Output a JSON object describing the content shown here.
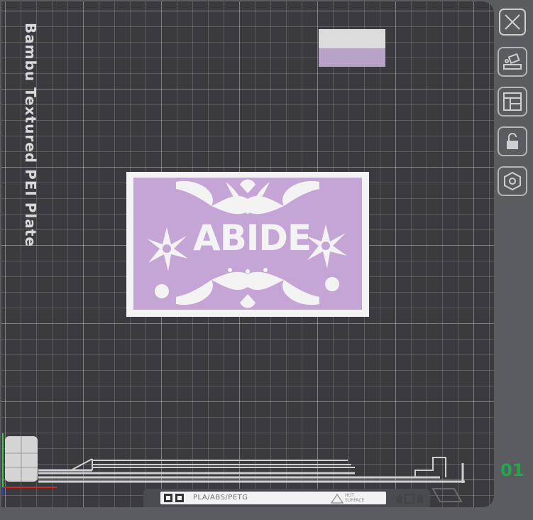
{
  "plate": {
    "name": "Bambu Textured PEI Plate",
    "number": "01",
    "material_label": "PLA/ABS/PETG",
    "hot_surface_label": [
      "HOT",
      "SURFACE"
    ]
  },
  "model": {
    "text": "ABIDE"
  },
  "colors": {
    "plate_bg": "#3b3a40",
    "model_base": "#f3f3f3",
    "model_accent": "#c5a4d6",
    "swatch_top": "#dcdcdc",
    "swatch_bottom": "#b8a2c8",
    "plate_number": "#1faa4a"
  },
  "side_toolbar": {
    "icons": [
      "close-icon",
      "auto-arrange-icon",
      "layout-icon",
      "unlock-icon",
      "settings-icon"
    ]
  }
}
